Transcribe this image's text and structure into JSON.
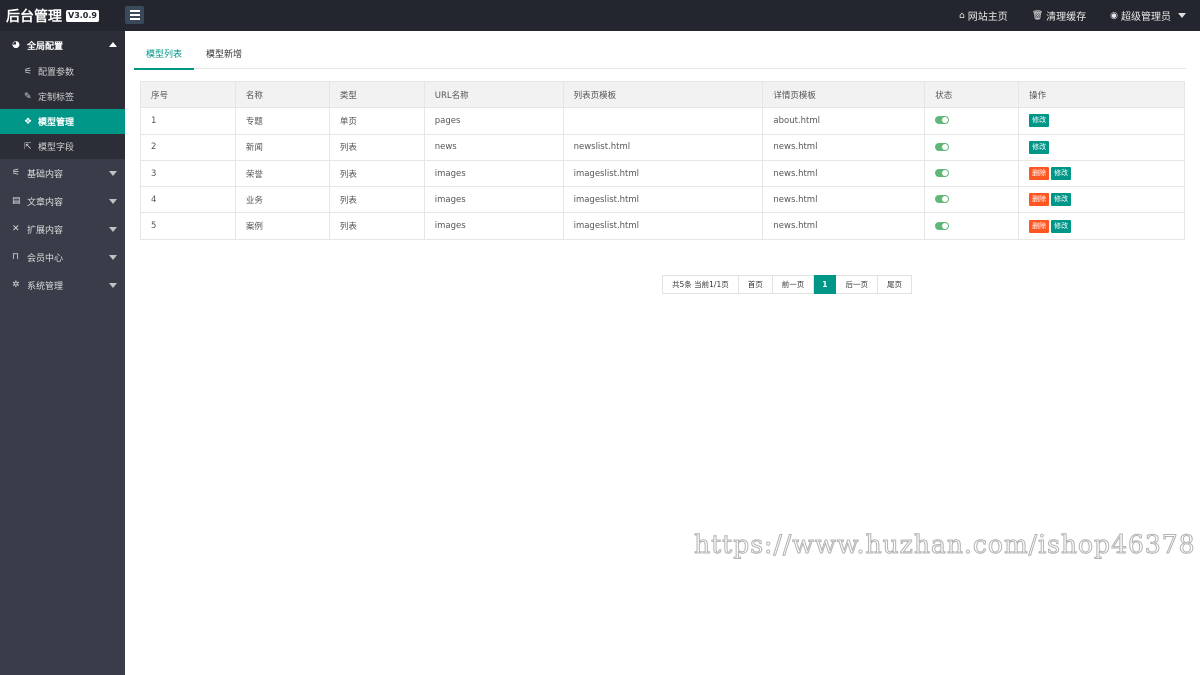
{
  "header": {
    "title": "后台管理",
    "version": "V3.0.9",
    "nav": [
      {
        "icon": "home-icon",
        "label": "网站主页"
      },
      {
        "icon": "trash-icon",
        "label": "清理缓存"
      },
      {
        "icon": "user-icon",
        "label": "超级管理员"
      }
    ]
  },
  "sidebar": {
    "groups": [
      {
        "icon": "globe-icon",
        "label": "全局配置",
        "open": true,
        "children": [
          {
            "icon": "sliders-icon",
            "label": "配置参数"
          },
          {
            "icon": "wrench-icon",
            "label": "定制标签"
          },
          {
            "icon": "cube-icon",
            "label": "模型管理",
            "active": true
          },
          {
            "icon": "external-link-icon",
            "label": "模型字段"
          }
        ]
      },
      {
        "icon": "sliders-icon",
        "label": "基础内容"
      },
      {
        "icon": "file-icon",
        "label": "文章内容"
      },
      {
        "icon": "expand-icon",
        "label": "扩展内容"
      },
      {
        "icon": "lock-icon",
        "label": "会员中心"
      },
      {
        "icon": "gear-icon",
        "label": "系统管理"
      }
    ]
  },
  "tabs": [
    {
      "label": "模型列表",
      "active": true
    },
    {
      "label": "模型新增"
    }
  ],
  "table": {
    "headers": [
      "序号",
      "名称",
      "类型",
      "URL名称",
      "列表页模板",
      "详情页模板",
      "状态",
      "操作"
    ],
    "rows": [
      {
        "id": "1",
        "name": "专题",
        "type": "单页",
        "url": "pages",
        "list_tpl": "",
        "detail_tpl": "about.html",
        "status_on": true,
        "deletable": false
      },
      {
        "id": "2",
        "name": "新闻",
        "type": "列表",
        "url": "news",
        "list_tpl": "newslist.html",
        "detail_tpl": "news.html",
        "status_on": true,
        "deletable": false
      },
      {
        "id": "3",
        "name": "荣誉",
        "type": "列表",
        "url": "images",
        "list_tpl": "imageslist.html",
        "detail_tpl": "news.html",
        "status_on": true,
        "deletable": true
      },
      {
        "id": "4",
        "name": "业务",
        "type": "列表",
        "url": "images",
        "list_tpl": "imageslist.html",
        "detail_tpl": "news.html",
        "status_on": true,
        "deletable": true
      },
      {
        "id": "5",
        "name": "案例",
        "type": "列表",
        "url": "images",
        "list_tpl": "imageslist.html",
        "detail_tpl": "news.html",
        "status_on": true,
        "deletable": true
      }
    ],
    "delete_label": "删除",
    "edit_label": "修改"
  },
  "pager": {
    "summary": "共5条 当前1/1页",
    "first": "首页",
    "prev": "前一页",
    "current": "1",
    "next": "后一页",
    "last": "尾页"
  },
  "watermark": "https://www.huzhan.com/ishop46378",
  "colors": {
    "accent": "#009688",
    "danger": "#ff5722",
    "toggle_on": "#5fb878",
    "header_bg": "#23262e",
    "sidebar_bg": "#393d49"
  }
}
